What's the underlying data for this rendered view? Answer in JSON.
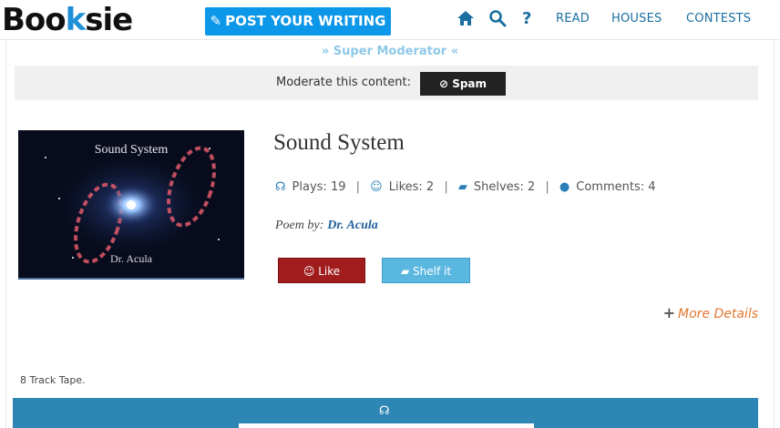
{
  "header": {
    "logo": {
      "prefix": "Boo",
      "k": "k",
      "suffix": "sie"
    },
    "post_button": "POST YOUR WRITING",
    "nav": [
      "READ",
      "HOUSES",
      "CONTESTS"
    ],
    "icons": [
      "home-icon",
      "search-icon",
      "help-icon"
    ],
    "help_glyph": "?"
  },
  "moderation": {
    "role": "» Super Moderator «",
    "label": "Moderate this content:",
    "spam_button": "Spam"
  },
  "work": {
    "cover": {
      "title": "Sound System",
      "author": "Dr. Acula"
    },
    "title": "Sound System",
    "stats": {
      "plays": "Plays: 19",
      "likes": "Likes: 2",
      "shelves": "Shelves: 2",
      "comments": "Comments: 4"
    },
    "byline_prefix": "Poem by:",
    "author": "Dr. Acula",
    "like_button": "Like",
    "shelf_button": "Shelf it",
    "more_details": "More Details",
    "description": "8 Track Tape."
  },
  "colors": {
    "accent": "#0d97e8",
    "nav": "#1a6fa0",
    "like": "#a11d1d",
    "shelf": "#5ab7df",
    "player": "#2e86b4",
    "more_details": "#e07830"
  }
}
